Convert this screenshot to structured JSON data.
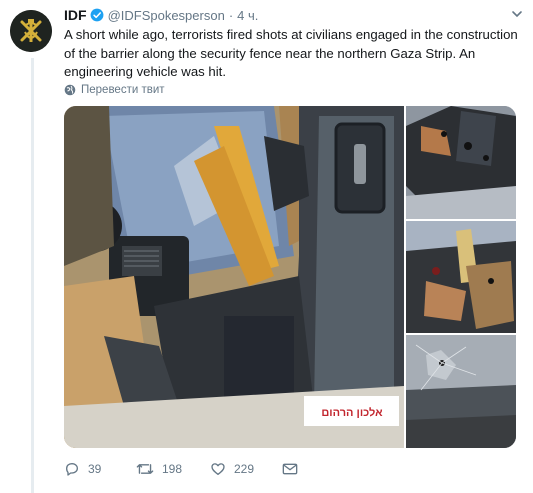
{
  "tweet": {
    "author_name": "IDF",
    "handle": "@IDFSpokesperson",
    "separator": "·",
    "time": "4 ч.",
    "text": "A short while ago, terrorists fired shots at civilians engaged in the construction of the barrier along the security fence near the northern Gaza Strip. An engineering vehicle was hit.",
    "translate_label": "Перевести твит",
    "media_sign_text": "אלכון הרהום",
    "actions": {
      "replies": "39",
      "retweets": "198",
      "likes": "229"
    }
  },
  "colors": {
    "text": "#14171a",
    "secondary": "#657786",
    "verified": "#1da1f2",
    "thread_line": "#e6ecf0",
    "avatar_bg": "#1f2420",
    "avatar_emblem": "#d4b03a"
  },
  "icons": [
    "verified-badge-icon",
    "chevron-down-icon",
    "globe-icon",
    "reply-icon",
    "retweet-icon",
    "like-icon",
    "message-icon"
  ]
}
